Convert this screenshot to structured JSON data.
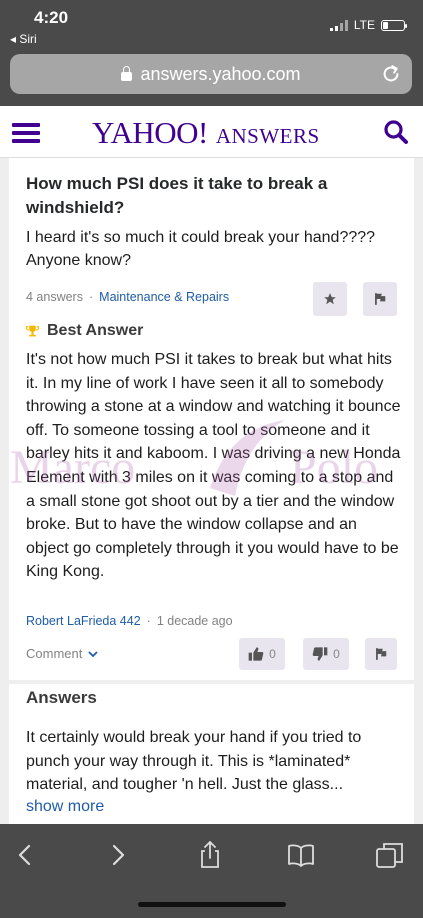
{
  "status_bar": {
    "time": "4:20",
    "back_label": "◂ Siri",
    "network": "LTE"
  },
  "browser": {
    "url": "answers.yahoo.com"
  },
  "header": {
    "logo_text": "YAHOO!",
    "logo_sub": "ANSWERS",
    "brand_color": "#400090"
  },
  "question": {
    "title": "How much PSI does it take to break a windshield?",
    "body": "I heard it's so much it could break your hand???? Anyone know?",
    "answers_count": "4 answers",
    "separator": "·",
    "category": "Maintenance & Repairs"
  },
  "best_answer": {
    "label": "Best Answer",
    "text": "It's not how much PSI it takes to break but what hits it. In my line of work I have seen it all to somebody throwing a stone at a window and watching it bounce off. To someone tossing a tool to someone and it barley hits it and kaboom. I was driving a new Honda Element with 3 miles on it was coming to a stop and a small stone got shoot out by a tier and the window broke. But to have the window collapse and an object go completely through it you would have to be King Kong.",
    "author": "Robert LaFrieda 442",
    "separator": "·",
    "time_ago": "1 decade ago",
    "comment_label": "Comment",
    "upvotes": "0",
    "downvotes": "0"
  },
  "watermark": {
    "left": "Marco",
    "right": "Polo"
  },
  "answers": {
    "heading": "Answers",
    "first_text": "It certainly would break your hand if you tried to punch your way through it. This is *laminated* material, and tougher 'n hell. Just the glass...",
    "show_more": "show more"
  },
  "toolbar": {
    "icons": [
      "back-icon",
      "forward-icon",
      "share-icon",
      "bookmarks-icon",
      "tabs-icon"
    ]
  }
}
